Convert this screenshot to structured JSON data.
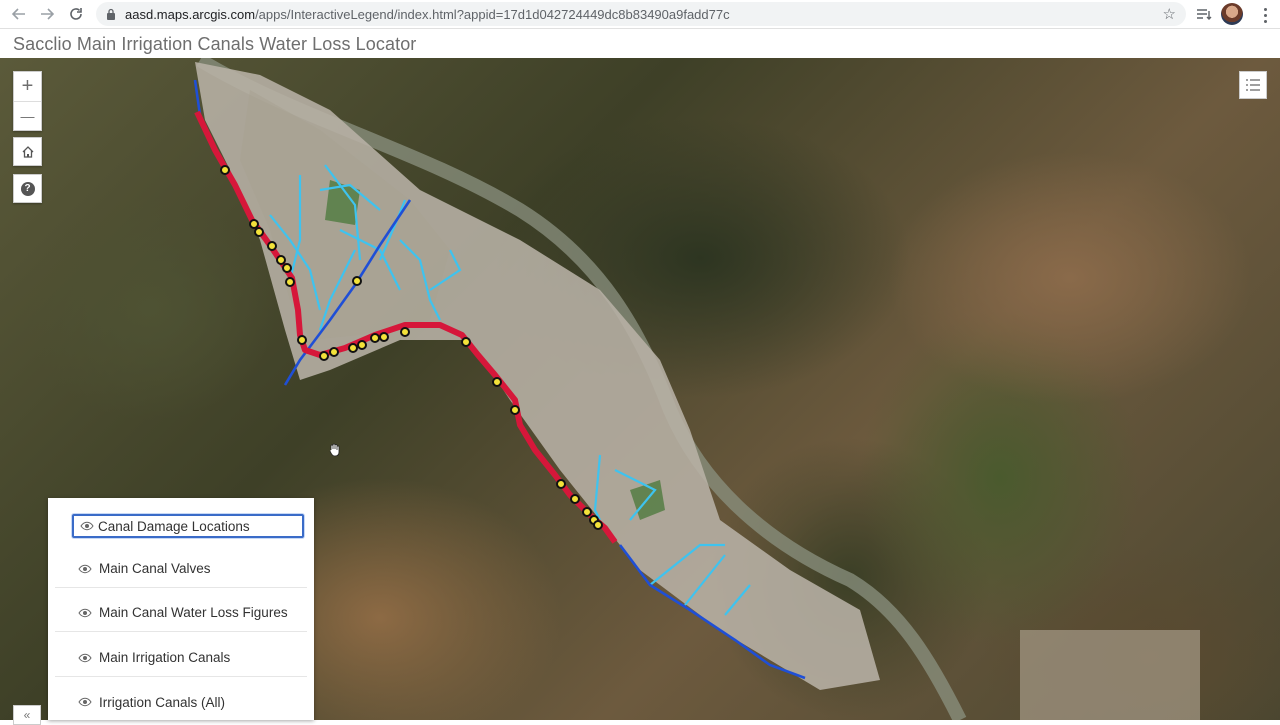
{
  "browser": {
    "url_host": "aasd.maps.arcgis.com",
    "url_path": "/apps/InteractiveLegend/index.html?appid=17d1d042724449dc8b83490a9fadd77c"
  },
  "app": {
    "title": "Sacclio Main Irrigation Canals Water Loss Locator"
  },
  "map_controls": {
    "zoom_in": "+",
    "zoom_out": "—",
    "help": "?"
  },
  "layers": {
    "items": [
      {
        "label": "Canal Damage Locations",
        "selected": true
      },
      {
        "label": "Main Canal Valves"
      },
      {
        "label": "Main Canal Water Loss Figures"
      },
      {
        "label": "Main Irrigation Canals"
      },
      {
        "label": "Irrigation Canals (All)"
      }
    ],
    "collapse_label": "«"
  },
  "colors": {
    "damage_canal": "#d6173a",
    "main_canal": "#1f4fd6",
    "irrigation_canal": "#3ec3ef",
    "focus": "#3a6bc8"
  }
}
